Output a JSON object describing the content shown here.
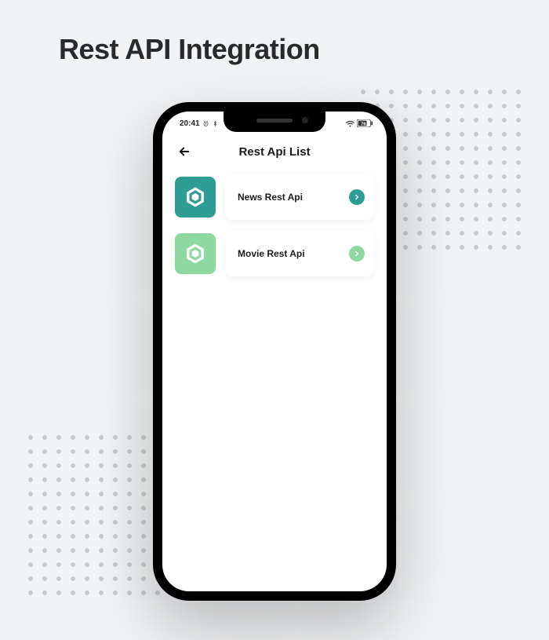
{
  "page": {
    "title": "Rest API Integration"
  },
  "status": {
    "time": "20:41",
    "battery": "76"
  },
  "nav": {
    "title": "Rest Api List"
  },
  "items": [
    {
      "label": "News Rest Api",
      "icon": "hex-logo",
      "color": "#2e9e94"
    },
    {
      "label": "Movie Rest Api",
      "icon": "hex-logo",
      "color": "#8fd89f"
    }
  ]
}
